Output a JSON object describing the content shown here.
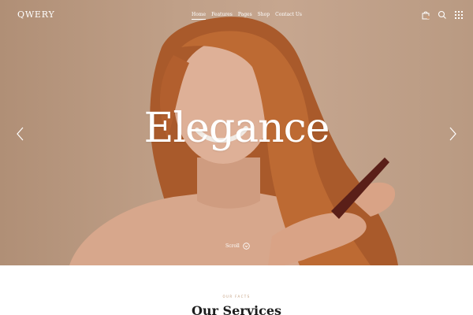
{
  "brand": {
    "logo": "QWERY"
  },
  "nav": {
    "items": [
      {
        "label": "Home",
        "active": true
      },
      {
        "label": "Features",
        "active": false
      },
      {
        "label": "Pages",
        "active": false
      },
      {
        "label": "Shop",
        "active": false
      },
      {
        "label": "Contact Us",
        "active": false
      }
    ]
  },
  "header_icons": [
    "bag-icon",
    "search-icon",
    "grid-menu-icon"
  ],
  "hero": {
    "headline": "Elegance",
    "scroll_label": "Scroll",
    "prev_icon": "chevron-left-icon",
    "next_icon": "chevron-right-icon"
  },
  "services": {
    "eyebrow": "OUR FACTS",
    "title": "Our Services"
  },
  "colors": {
    "hero_background": "#c0a088",
    "hair": "#b9652f",
    "accent": "#c19b7a",
    "title_text": "#1d1d1d"
  }
}
